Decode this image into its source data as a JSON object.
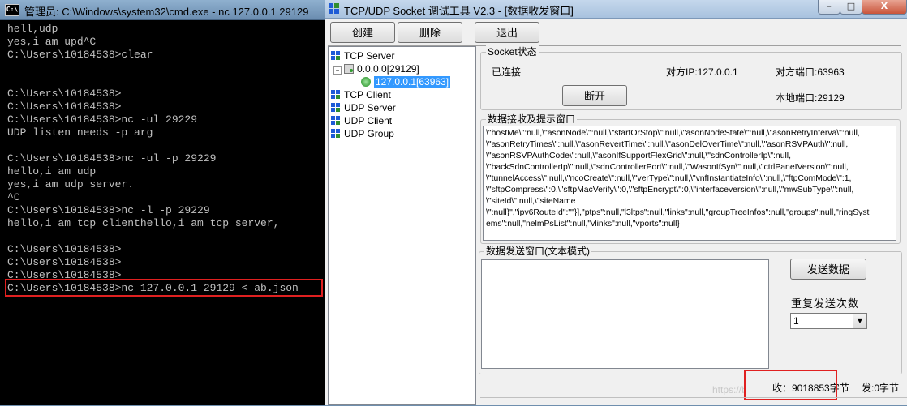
{
  "cmd_window": {
    "title": "管理员: C:\\Windows\\system32\\cmd.exe - nc  127.0.0.1 29129",
    "icon": "cmd-icon",
    "lines": [
      "hell,udp",
      "yes,i am upd^C",
      "C:\\Users\\10184538>clear",
      "",
      "",
      "C:\\Users\\10184538>",
      "C:\\Users\\10184538>",
      "C:\\Users\\10184538>nc -ul 29229",
      "UDP listen needs -p arg",
      "",
      "C:\\Users\\10184538>nc -ul -p 29229",
      "hello,i am udp",
      "yes,i am udp server.",
      "^C",
      "C:\\Users\\10184538>nc -l -p 29229",
      "hello,i am tcp clienthello,i am tcp server,",
      "",
      "C:\\Users\\10184538>",
      "C:\\Users\\10184538>",
      "C:\\Users\\10184538>",
      "C:\\Users\\10184538>nc 127.0.0.1 29129 < ab.json"
    ]
  },
  "socket_window": {
    "title": "TCP/UDP Socket 调试工具 V2.3 - [数据收发窗口]",
    "window_controls": [
      "–",
      "□",
      "X"
    ],
    "toolbar": {
      "create": "创建",
      "delete": "删除",
      "exit": "退出"
    },
    "tree": {
      "tcp_server": "TCP Server",
      "server_node": "0.0.0.0[29129]",
      "connection_node": "127.0.0.1[63963]",
      "tcp_client": "TCP Client",
      "udp_server": "UDP Server",
      "udp_client": "UDP Client",
      "udp_group": "UDP Group"
    },
    "socket_status": {
      "title": "Socket状态",
      "state": "已连接",
      "peer_ip": "对方IP:127.0.0.1",
      "peer_port": "对方端口:63963",
      "disconnect": "断开",
      "local_port": "本地端口:29129"
    },
    "receive": {
      "title": "数据接收及提示窗口",
      "lines": [
        "\\\"hostMe\\\":null,\\\"asonNode\\\":null,\\\"startOrStop\\\":null,\\\"asonNodeState\\\":null,\\\"asonRetryInterva\\\":null,",
        "\\\"asonRetryTimes\\\":null,\\\"asonRevertTime\\\":null,\\\"asonDelOverTime\\\":null,\\\"asonRSVPAuth\\\":null,",
        "\\\"asonRSVPAuthCode\\\":null,\\\"asonIfSupportFlexGrid\\\":null,\\\"sdnControllerIp\\\":null,",
        "\\\"backSdnControllerIp\\\":null,\\\"sdnControllerPort\\\":null,\\\"WasonIfSyn\\\":null,\\\"ctrlPaneIVersion\\\":null,",
        "\\\"tunnelAccess\\\":null,\\\"ncoCreate\\\":null,\\\"verType\\\":null,\\\"vnfInstantiateInfo\\\":null,\\\"ftpComMode\\\":1,",
        "\\\"sftpCompress\\\":0,\\\"sftpMacVerify\\\":0,\\\"sftpEncrypt\\\":0,\\\"interfaceversion\\\":null,\\\"mwSubType\\\":null,",
        "\\\"siteId\\\":null,\\\"siteName",
        "\\\":null}\",\"ipv6RouteId\":\"\"}],\"ptps\":null,\"l3ltps\":null,\"links\":null,\"groupTreeInfos\":null,\"groups\":null,\"ringSyst",
        "ems\":null,\"nelmPsList\":null,\"vlinks\":null,\"vports\":null}"
      ]
    },
    "send": {
      "title": "数据发送窗口(文本模式)",
      "value": "",
      "send_button": "发送数据",
      "repeat_label": "重复发送次数",
      "repeat_value": "1"
    },
    "status_bar": {
      "received": "收：9018853字节",
      "sent": "发:0字节"
    },
    "watermark": "https://blog"
  }
}
